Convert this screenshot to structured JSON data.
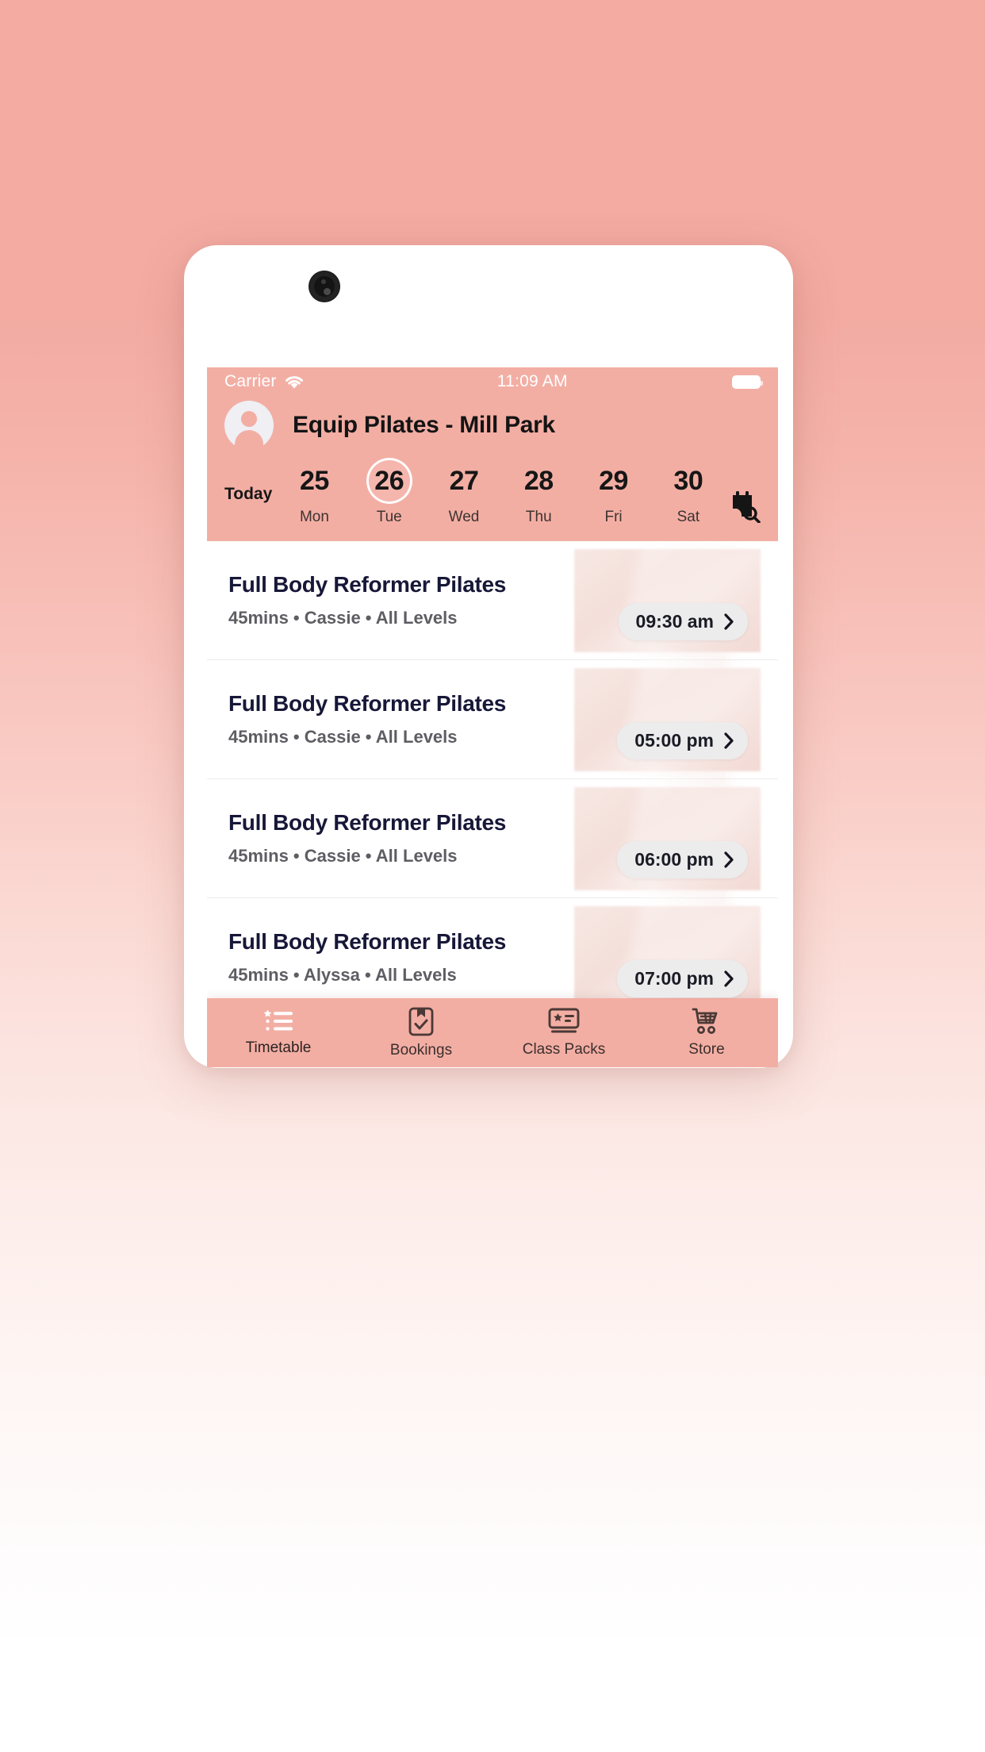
{
  "device": {
    "camera_icon": "camera-lens-icon"
  },
  "status_bar": {
    "carrier": "Carrier",
    "wifi_icon": "wifi-icon",
    "time": "11:09 AM",
    "battery_icon": "battery-full-icon"
  },
  "header": {
    "avatar_icon": "user-avatar-icon",
    "venue_title": "Equip Pilates - Mill Park",
    "accent_color": "#f3aea4"
  },
  "date_strip": {
    "today_label": "Today",
    "calendar_search_icon": "calendar-search-icon",
    "selected_index": 1,
    "days": [
      {
        "num": "25",
        "dow": "Mon"
      },
      {
        "num": "26",
        "dow": "Tue"
      },
      {
        "num": "27",
        "dow": "Wed"
      },
      {
        "num": "28",
        "dow": "Thu"
      },
      {
        "num": "29",
        "dow": "Fri"
      },
      {
        "num": "30",
        "dow": "Sat"
      }
    ]
  },
  "classes": [
    {
      "name": "Full Body Reformer Pilates",
      "meta": "45mins • Cassie • All Levels",
      "time": "09:30 am",
      "chevron_icon": "chevron-right-icon"
    },
    {
      "name": "Full Body Reformer Pilates",
      "meta": "45mins • Cassie • All Levels",
      "time": "05:00 pm",
      "chevron_icon": "chevron-right-icon"
    },
    {
      "name": "Full Body Reformer Pilates",
      "meta": "45mins • Cassie • All Levels",
      "time": "06:00 pm",
      "chevron_icon": "chevron-right-icon"
    },
    {
      "name": "Full Body Reformer Pilates",
      "meta": "45mins • Alyssa • All Levels",
      "time": "07:00 pm",
      "chevron_icon": "chevron-right-icon"
    }
  ],
  "tab_bar": {
    "active_index": 0,
    "tabs": [
      {
        "label": "Timetable",
        "icon": "list-star-icon"
      },
      {
        "label": "Bookings",
        "icon": "clipboard-check-icon"
      },
      {
        "label": "Class Packs",
        "icon": "ticket-star-icon"
      },
      {
        "label": "Store",
        "icon": "shopping-cart-icon"
      }
    ]
  }
}
